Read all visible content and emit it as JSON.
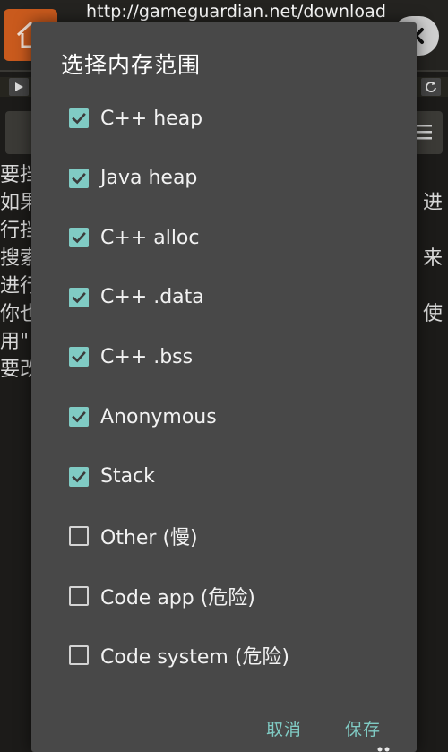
{
  "url": "http://gameguardian.net/download",
  "icons": {
    "home": "home-icon",
    "close": "close-icon",
    "play": "play-icon",
    "refresh": "refresh-icon",
    "menu": "menu-icon",
    "checkbox_checked": "checkbox-checked-icon",
    "checkbox_unchecked": "checkbox-unchecked-icon"
  },
  "colors": {
    "accent": "#80cbc4",
    "dialog_bg": "#484848",
    "home_button": "#c95a1d"
  },
  "background_text": {
    "lines": [
      {
        "left": "要挡",
        "right": ""
      },
      {
        "left": "如果",
        "right": "。进"
      },
      {
        "left": "行挡",
        "right": ""
      },
      {
        "left": "搜索",
        "right": "来"
      },
      {
        "left": "进行",
        "right": ""
      },
      {
        "left": "你也",
        "right": "使"
      },
      {
        "left": "用\"",
        "right": ""
      },
      {
        "left": "要改",
        "right": ""
      }
    ]
  },
  "dialog": {
    "title": "选择内存范围",
    "options": [
      {
        "label": "C++ heap",
        "checked": true
      },
      {
        "label": "Java heap",
        "checked": true
      },
      {
        "label": "C++ alloc",
        "checked": true
      },
      {
        "label": "C++ .data",
        "checked": true
      },
      {
        "label": "C++ .bss",
        "checked": true
      },
      {
        "label": "Anonymous",
        "checked": true
      },
      {
        "label": "Stack",
        "checked": true
      },
      {
        "label": "Other (慢)",
        "checked": false
      },
      {
        "label": "Code app (危险)",
        "checked": false
      },
      {
        "label": "Code system (危险)",
        "checked": false
      }
    ],
    "cancel_label": "取消",
    "save_label": "保存"
  }
}
